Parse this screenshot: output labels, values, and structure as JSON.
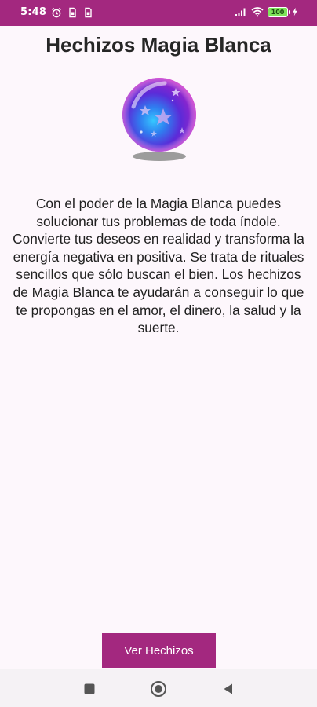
{
  "status_bar": {
    "time": "5:48",
    "battery": "100"
  },
  "header": {
    "title": "Hechizos Magia Blanca"
  },
  "main": {
    "description": "Con el poder de la Magia Blanca puedes solucionar tus problemas de toda índole. Convierte tus deseos en realidad y transforma la energía negativa en positiva. Se trata de rituales sencillos que sólo buscan el bien. Los hechizos de Magia Blanca te ayudarán a conseguir lo que te propongas en el amor, el dinero, la salud y la suerte.",
    "button_label": "Ver Hechizos"
  },
  "nav_bar": {
    "buttons": [
      "recents-icon",
      "home-icon",
      "back-icon"
    ]
  },
  "colors": {
    "accent": "#a3287f",
    "background": "#fdf7fc"
  }
}
